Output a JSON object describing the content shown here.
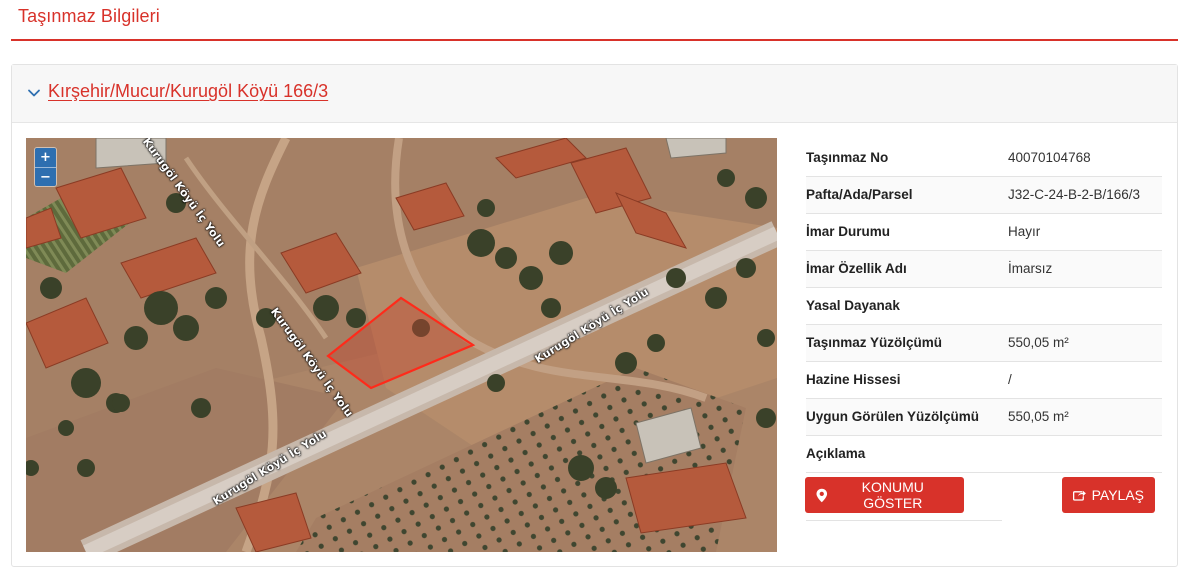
{
  "page": {
    "title": "Taşınmaz Bilgileri"
  },
  "parcel": {
    "heading": "Kırşehir/Mucur/Kurugöl Köyü 166/3"
  },
  "map": {
    "zoom_in_label": "+",
    "zoom_out_label": "−",
    "road_labels": [
      "Kurugöl Köyü İç Yolu",
      "Kurugöl Köyü İç Yolu",
      "Kurugöl Köyü İç Yolu",
      "Kurugöl Köyü İç Yolu"
    ],
    "parcel_outline_color": "#ff2a1a"
  },
  "details": [
    {
      "label": "Taşınmaz No",
      "value": "40070104768"
    },
    {
      "label": "Pafta/Ada/Parsel",
      "value": "J32-C-24-B-2-B/166/3"
    },
    {
      "label": "İmar Durumu",
      "value": "Hayır"
    },
    {
      "label": "İmar Özellik Adı",
      "value": "İmarsız"
    },
    {
      "label": "Yasal Dayanak",
      "value": ""
    },
    {
      "label": "Taşınmaz Yüzölçümü",
      "value": "550,05 m²"
    },
    {
      "label": "Hazine Hissesi",
      "value": "/"
    },
    {
      "label": "Uygun Görülen Yüzölçümü",
      "value": "550,05 m²"
    },
    {
      "label": "Açıklama",
      "value": ""
    }
  ],
  "actions": {
    "locate_label": "KONUMU GÖSTER",
    "share_label": "PAYLAŞ"
  },
  "colors": {
    "accent": "#d8322a",
    "zoom_button": "#2e6fb0"
  }
}
